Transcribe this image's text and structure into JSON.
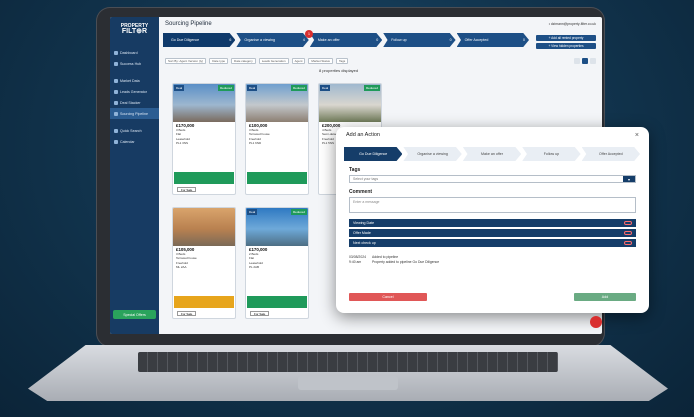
{
  "app": {
    "logo_line1": "PROPERTY",
    "logo_line2": "FILT⊕R",
    "page_title": "Sourcing Pipeline",
    "user_email": "&#8226; dzimann@property-filter.co.uk"
  },
  "sidebar": {
    "items": [
      {
        "label": "Dashboard",
        "icon": "dashboard-icon",
        "active": false
      },
      {
        "label": "Success Hub",
        "icon": "hub-icon",
        "active": false
      },
      {
        "label": "Market Data",
        "icon": "chart-icon",
        "active": false
      },
      {
        "label": "Leads Generator",
        "icon": "leads-icon",
        "active": false
      },
      {
        "label": "Deal Stacker",
        "icon": "stack-icon",
        "active": false
      },
      {
        "label": "Sourcing Pipeline",
        "icon": "pipeline-icon",
        "active": true
      },
      {
        "label": "Quick Search",
        "icon": "search-icon",
        "active": false
      },
      {
        "label": "Calendar",
        "icon": "calendar-icon",
        "active": false
      }
    ],
    "special_offers": "Special Offers"
  },
  "pipeline": {
    "stages": [
      {
        "label": "Go Due Diligence",
        "count": "6"
      },
      {
        "label": "Organise a viewing",
        "count": "4"
      },
      {
        "label": "Make an offer",
        "count": "0"
      },
      {
        "label": "Follow up",
        "count": "0"
      },
      {
        "label": "Offer Accepted",
        "count": "0"
      }
    ],
    "badge": "1",
    "side_buttons": [
      "+ Add all rented property",
      "+ View hidden properties"
    ]
  },
  "filters": [
    "Sort By: Agent Version (ty)",
    "Date type",
    "Date category",
    "Leads Generation",
    "Agent",
    "Market Status",
    "Tags"
  ],
  "count_text": "8 properties displayed",
  "cards": [
    {
      "price": "£170,000",
      "beds": "3 Beds",
      "type": "Flat",
      "tenure": "Leasehold",
      "postcode": "PL1 3NS",
      "status": "For Sale",
      "tag_l": "Deal",
      "tag_r": "Reduced"
    },
    {
      "price": "£100,000",
      "beds": "3 Beds",
      "type": "Terraced house",
      "tenure": "Freehold",
      "postcode": "PL1 6ND",
      "status": "",
      "tag_l": "Deal",
      "tag_r": "Reduced"
    },
    {
      "price": "£200,000",
      "beds": "4 Beds",
      "type": "Semi-detached house",
      "tenure": "Freehold",
      "postcode": "PL1 5NS",
      "status": "",
      "tag_l": "Deal",
      "tag_r": "Reduced"
    },
    {
      "price": "£105,000",
      "beds": "3 Beds",
      "type": "Terraced house",
      "tenure": "Freehold",
      "postcode": "ML 2AA",
      "status": "For Sale",
      "tag_l": "",
      "tag_r": ""
    },
    {
      "price": "£170,000",
      "beds": "2 Beds",
      "type": "Flat",
      "tenure": "Leasehold",
      "postcode": "PL 2AB",
      "status": "For Sale",
      "tag_l": "Deal",
      "tag_r": "Reduced"
    }
  ],
  "modal": {
    "title": "Add an Action",
    "close": "×",
    "stages": [
      "Go Due Diligence",
      "Organise a viewing",
      "Make an offer",
      "Follow up",
      "Offer Accepted"
    ],
    "tags_label": "Tags",
    "tags_placeholder": "Select your tags",
    "comment_label": "Comment",
    "comment_placeholder": "Enter a message",
    "sections": [
      "Viewing Date",
      "Offer Made",
      "Next check up"
    ],
    "history_date": "03/08/2024",
    "history_time": "9:40 am",
    "history_line1": "Added to pipeline",
    "history_line2": "Property added to pipeline Go Due Diligence",
    "cancel": "Cancel",
    "add": "Add"
  }
}
